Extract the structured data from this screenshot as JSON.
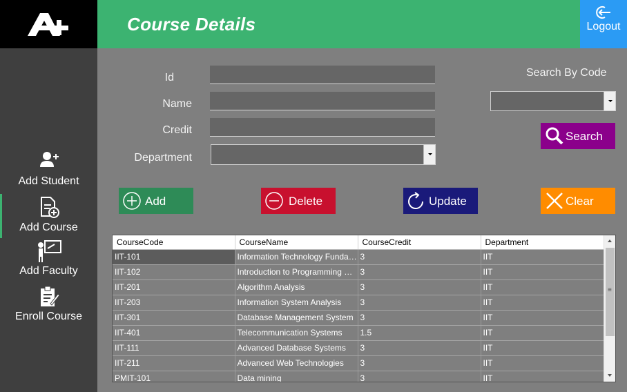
{
  "header": {
    "title": "Course Details",
    "logout_label": "Logout"
  },
  "sidebar": {
    "items": [
      {
        "label": "Add Student",
        "icon": "user-plus-icon"
      },
      {
        "label": "Add Course",
        "icon": "document-plus-icon"
      },
      {
        "label": "Add Faculty",
        "icon": "teacher-board-icon"
      },
      {
        "label": "Enroll Course",
        "icon": "clipboard-edit-icon"
      }
    ]
  },
  "form": {
    "id_label": "Id",
    "id_value": "",
    "name_label": "Name",
    "name_value": "",
    "credit_label": "Credit",
    "credit_value": "",
    "department_label": "Department",
    "department_value": ""
  },
  "search": {
    "label": "Search By Code",
    "selected": "",
    "button_label": "Search"
  },
  "buttons": {
    "add": "Add",
    "delete": "Delete",
    "update": "Update",
    "clear": "Clear"
  },
  "colors": {
    "header_green": "#3cb371",
    "logout_blue": "#2b9bf4",
    "add_green": "#2e8b57",
    "delete_red": "#c8102e",
    "update_navy": "#1a1a7a",
    "clear_orange": "#ff8c00",
    "search_purple": "#8b008b"
  },
  "grid": {
    "columns": [
      "CourseCode",
      "CourseName",
      "CourseCredit",
      "Department"
    ],
    "rows": [
      [
        "IIT-101",
        "Information Technology Fundame...",
        "3",
        "IIT"
      ],
      [
        "IIT-102",
        "Introduction to Programming Envir...",
        "3",
        "IIT"
      ],
      [
        "IIT-201",
        "Algorithm Analysis",
        "3",
        "IIT"
      ],
      [
        "IIT-203",
        "Information System Analysis",
        "3",
        "IIT"
      ],
      [
        "IIT-301",
        "Database Management System",
        "3",
        "IIT"
      ],
      [
        "IIT-401",
        "Telecommunication Systems",
        "1.5",
        "IIT"
      ],
      [
        "IIT-111",
        "Advanced Database Systems",
        "3",
        "IIT"
      ],
      [
        "IIT-211",
        "Advanced Web Technologies",
        "3",
        "IIT"
      ],
      [
        "PMIT-101",
        "Data mining",
        "3",
        "IIT"
      ]
    ]
  }
}
